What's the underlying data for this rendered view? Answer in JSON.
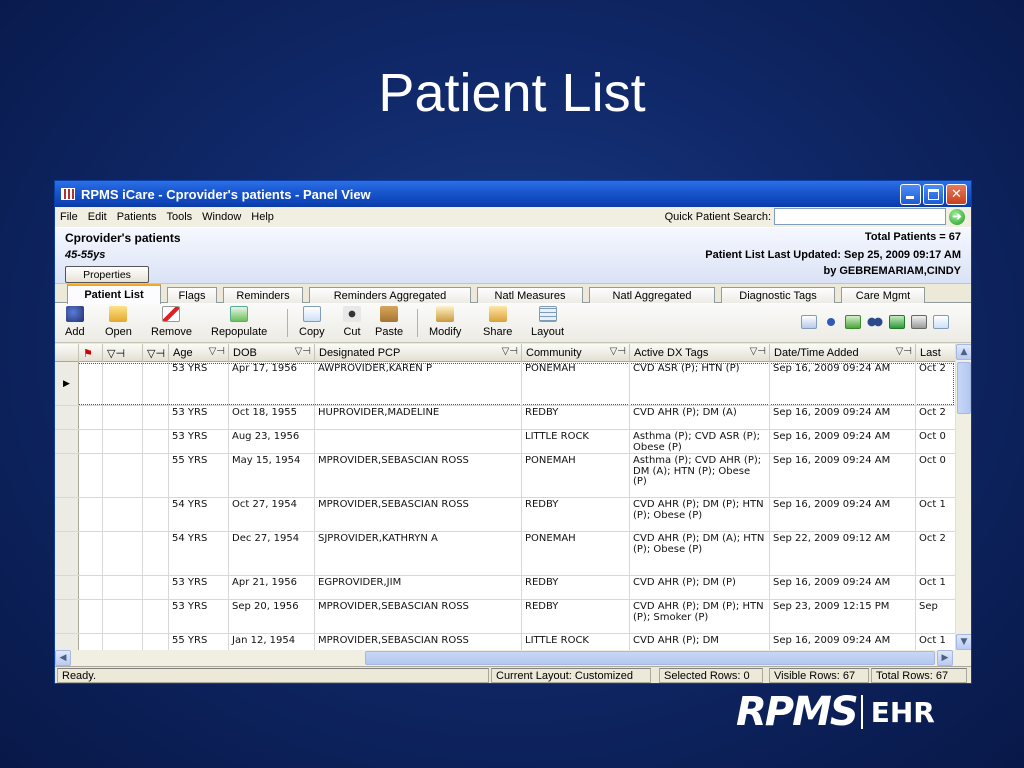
{
  "slide": {
    "title": "Patient List"
  },
  "window": {
    "title": "RPMS iCare - Cprovider's patients - Panel View"
  },
  "menu": {
    "items": [
      "File",
      "Edit",
      "Patients",
      "Tools",
      "Window",
      "Help"
    ]
  },
  "quick_search": {
    "label": "Quick Patient Search:",
    "value": "",
    "placeholder": ""
  },
  "header": {
    "panel_name": "Cprovider's patients",
    "age_range": "45-55ys",
    "properties_label": "Properties",
    "total_patients": "Total Patients = 67",
    "last_updated": "Patient List Last Updated: Sep 25, 2009 09:17 AM",
    "by_user": "by GEBREMARIAM,CINDY"
  },
  "tabs": [
    "Patient List",
    "Flags",
    "Reminders",
    "Reminders Aggregated",
    "Natl Measures",
    "Natl Aggregated",
    "Diagnostic Tags",
    "Care Mgmt"
  ],
  "toolbar": {
    "add": "Add",
    "open": "Open",
    "remove": "Remove",
    "repopulate": "Repopulate",
    "copy": "Copy",
    "cut": "Cut",
    "paste": "Paste",
    "modify": "Modify",
    "share": "Share",
    "layout": "Layout"
  },
  "grid": {
    "headers": [
      "Age",
      "DOB",
      "Designated PCP",
      "Community",
      "Active DX Tags",
      "Date/Time Added",
      "Last"
    ],
    "rows": [
      [
        "53 YRS",
        "Apr 17, 1956",
        "AWPROVIDER,KAREN P",
        "PONEMAH",
        "CVD ASR (P); HTN (P)",
        "Sep 16, 2009 09:24 AM",
        "Oct 2"
      ],
      [
        "53 YRS",
        "Oct 18, 1955",
        "HUPROVIDER,MADELINE",
        "REDBY",
        "CVD AHR (P); DM (A)",
        "Sep 16, 2009 09:24 AM",
        "Oct 2"
      ],
      [
        "53 YRS",
        "Aug 23, 1956",
        "",
        "LITTLE ROCK",
        "Asthma (P); CVD ASR (P); Obese (P)",
        "Sep 16, 2009 09:24 AM",
        "Oct 0"
      ],
      [
        "55 YRS",
        "May 15, 1954",
        "MPROVIDER,SEBASCIAN ROSS",
        "PONEMAH",
        "Asthma (P); CVD AHR (P); DM (A); HTN (P); Obese (P)",
        "Sep 16, 2009 09:24 AM",
        "Oct 0"
      ],
      [
        "54 YRS",
        "Oct 27, 1954",
        "MPROVIDER,SEBASCIAN ROSS",
        "REDBY",
        "CVD AHR (P); DM (P); HTN (P); Obese (P)",
        "Sep 16, 2009 09:24 AM",
        "Oct 1"
      ],
      [
        "54 YRS",
        "Dec 27, 1954",
        "SJPROVIDER,KATHRYN A",
        "PONEMAH",
        "CVD AHR (P); DM (A); HTN (P); Obese (P)",
        "Sep 22, 2009 09:12 AM",
        "Oct 2"
      ],
      [
        "53 YRS",
        "Apr 21, 1956",
        "EGPROVIDER,JIM",
        "REDBY",
        "CVD AHR (P); DM (P)",
        "Sep 16, 2009 09:24 AM",
        "Oct 1"
      ],
      [
        "53 YRS",
        "Sep 20, 1956",
        "MPROVIDER,SEBASCIAN ROSS",
        "REDBY",
        "CVD AHR (P); DM (P); HTN (P); Smoker (P)",
        "Sep 23, 2009 12:15 PM",
        "Sep"
      ],
      [
        "55 YRS",
        "Jan 12, 1954",
        "MPROVIDER,SEBASCIAN ROSS",
        "LITTLE ROCK",
        "CVD AHR (P); DM",
        "Sep 16, 2009 09:24 AM",
        "Oct 1"
      ]
    ]
  },
  "status": {
    "ready": "Ready.",
    "layout": "Current Layout: Customized",
    "selected": "Selected Rows: 0",
    "visible": "Visible Rows: 67",
    "total": "Total Rows: 67"
  },
  "logo": {
    "text": "RPMS",
    "suffix": "EHR"
  }
}
